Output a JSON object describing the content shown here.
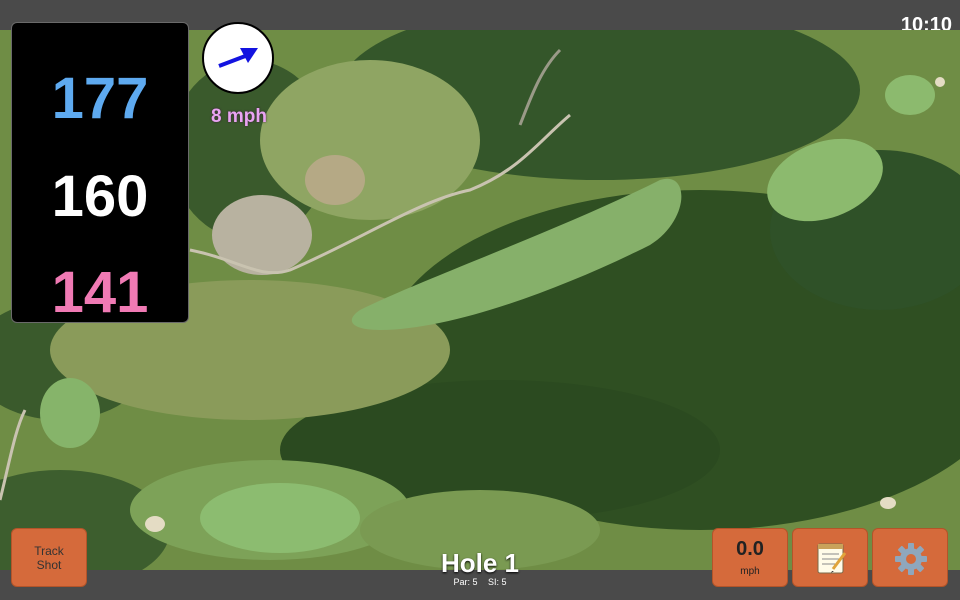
{
  "status": {
    "time": "10:10"
  },
  "distances": {
    "back": "177",
    "middle": "160",
    "front": "141"
  },
  "wind": {
    "speed": "8 mph",
    "direction_icon": "arrow-icon"
  },
  "buttons": {
    "track_shot_line1": "Track",
    "track_shot_line2": "Shot",
    "speed_value": "0.0",
    "speed_unit": "mph",
    "notes_icon": "notepad-icon",
    "settings_icon": "gear-icon"
  },
  "hole": {
    "title": "Hole 1",
    "par": "Par: 5",
    "si": "SI: 5"
  },
  "colors": {
    "back": "#5eaaf0",
    "middle": "#ffffff",
    "front": "#f07ab4",
    "wind_text": "#e9a4f2",
    "button": "#d56a3b"
  }
}
